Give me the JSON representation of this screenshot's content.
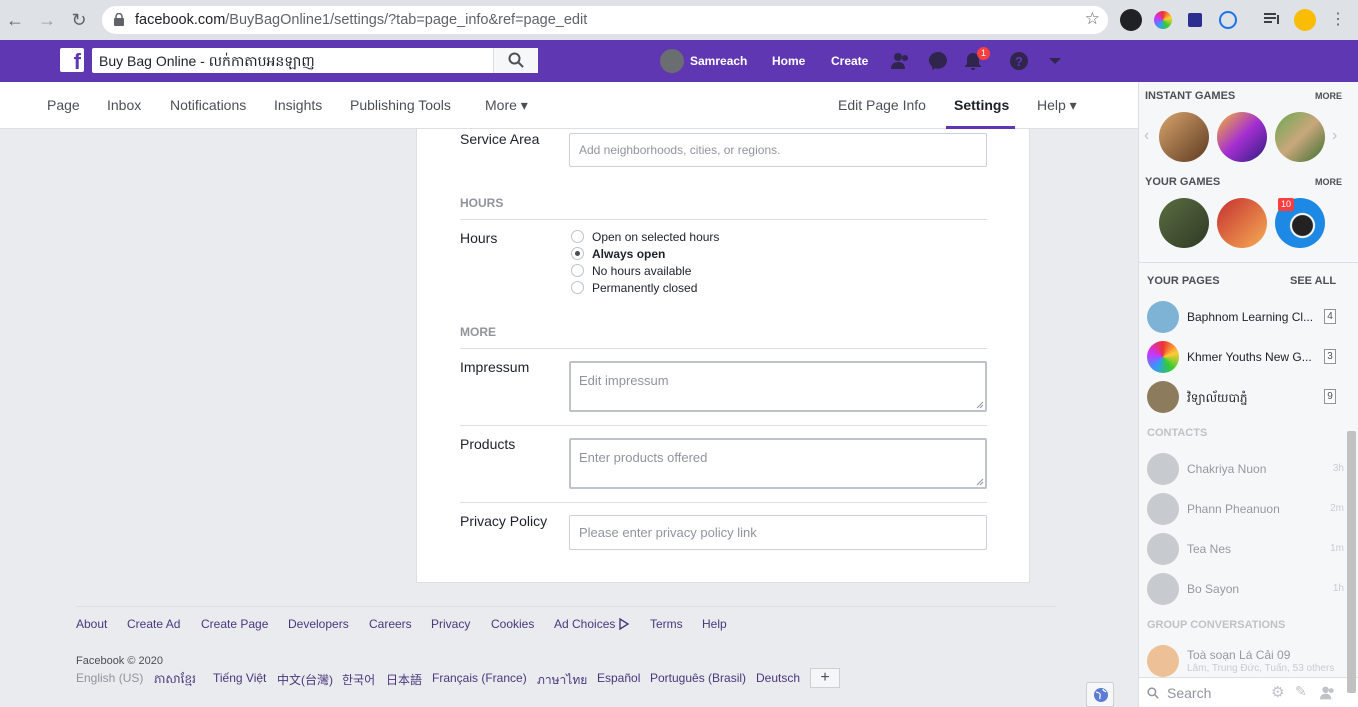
{
  "browser": {
    "url_host": "facebook.com",
    "url_path": "/BuyBagOnline1/settings/?tab=page_info&ref=page_edit"
  },
  "fb": {
    "search_value": "Buy Bag Online - លក់កាតាបអនឡាញ",
    "user_name": "Samreach",
    "home": "Home",
    "create": "Create",
    "notif_count": "1"
  },
  "subnav": {
    "left": [
      "Page",
      "Inbox",
      "Notifications",
      "Insights",
      "Publishing Tools",
      "More ▾"
    ],
    "right": [
      "Edit Page Info",
      "Settings",
      "Help ▾"
    ]
  },
  "form": {
    "service_area_label": "Service Area",
    "service_area_placeholder": "Add neighborhoods, cities, or regions.",
    "hours_section": "HOURS",
    "hours_label": "Hours",
    "hours_options": [
      "Open on selected hours",
      "Always open",
      "No hours available",
      "Permanently closed"
    ],
    "hours_selected": "Always open",
    "more_section": "MORE",
    "impressum_label": "Impressum",
    "impressum_placeholder": "Edit impressum",
    "products_label": "Products",
    "products_placeholder": "Enter products offered",
    "privacy_label": "Privacy Policy",
    "privacy_placeholder": "Please enter privacy policy link"
  },
  "footer": {
    "links": [
      "About",
      "Create Ad",
      "Create Page",
      "Developers",
      "Careers",
      "Privacy",
      "Cookies",
      "Ad Choices",
      "Terms",
      "Help"
    ],
    "copyright": "Facebook © 2020",
    "current_lang": "English (US)",
    "languages": [
      "ភាសាខ្មែរ",
      "Tiếng Việt",
      "中文(台灣)",
      "한국어",
      "日本語",
      "Français (France)",
      "ภาษาไทย",
      "Español",
      "Português (Brasil)",
      "Deutsch"
    ],
    "plus": "+"
  },
  "sidebar": {
    "instant_games": "INSTANT GAMES",
    "your_games": "YOUR GAMES",
    "more": "MORE",
    "game_badge": "10",
    "your_pages": "YOUR PAGES",
    "see_all": "SEE ALL",
    "pages": [
      {
        "name": "Baphnom Learning Cl...",
        "count": "4"
      },
      {
        "name": "Khmer Youths New G...",
        "count": "3"
      },
      {
        "name": "វិទ្យាល័យបាភ្នំ",
        "count": "9"
      }
    ],
    "contacts_title": "CONTACTS",
    "contacts": [
      {
        "name": "Chakriya Nuon",
        "time": "3h"
      },
      {
        "name": "Phann Pheanuon",
        "time": "2m"
      },
      {
        "name": "Tea Nes",
        "time": "1m"
      },
      {
        "name": "Bo Sayon",
        "time": "1h"
      }
    ],
    "group_title": "GROUP CONVERSATIONS",
    "group_name": "Toà soạn Lá Cải 09",
    "group_members": "Lâm, Trung Đức, Tuấn, 53 others",
    "chat_search_placeholder": "Search"
  }
}
